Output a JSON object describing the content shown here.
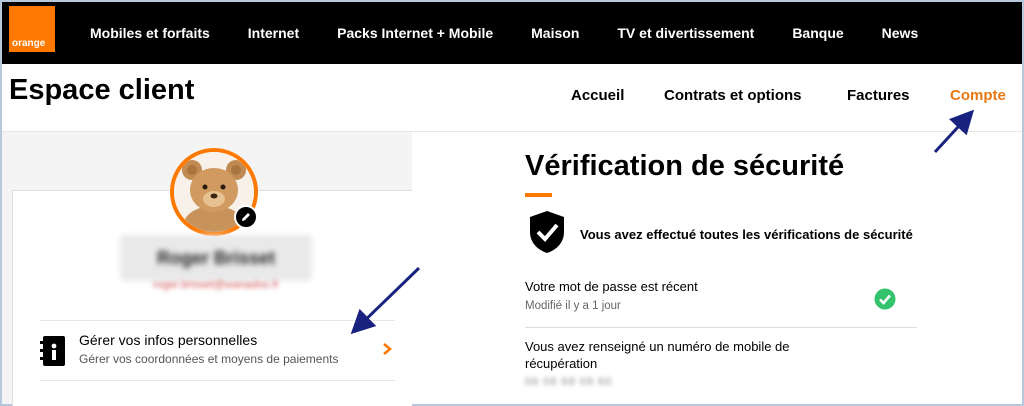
{
  "brand": {
    "logo_text": "orange",
    "accent": "#ff7900"
  },
  "topnav": {
    "items": [
      {
        "label": "Mobiles et forfaits"
      },
      {
        "label": "Internet"
      },
      {
        "label": "Packs Internet + Mobile"
      },
      {
        "label": "Maison"
      },
      {
        "label": "TV et divertissement"
      },
      {
        "label": "Banque"
      },
      {
        "label": "News"
      }
    ]
  },
  "header": {
    "title": "Espace client",
    "subnav": {
      "accueil": "Accueil",
      "contrats": "Contrats et options",
      "factures": "Factures",
      "compte": "Compte"
    },
    "active_color": "#e87812"
  },
  "profile": {
    "name": "Roger Brisset",
    "email": "roger.brisset@wanadoo.fr",
    "avatar_icon": "teddy-bear-avatar",
    "edit_icon": "pencil-icon"
  },
  "personal_info": {
    "title": "Gérer vos infos personnelles",
    "description": "Gérer vos coordonnées et moyens de paiements",
    "icon": "address-book-icon",
    "chevron_icon": "chevron-right-icon"
  },
  "security": {
    "title": "Vérification de sécurité",
    "status": "Vous avez effectué toutes les vérifications de sécurité",
    "status_icon": "shield-check-icon",
    "password": {
      "title": "Votre mot de passe est récent",
      "subtitle": "Modifié il y a 1 jour",
      "icon": "check-circle-icon",
      "icon_color": "#32c36c"
    },
    "mobile": {
      "title": "Vous avez renseigné un numéro de mobile de récupération",
      "number": "06 06 68 09 60"
    }
  },
  "annotation_color": "#1a2280"
}
